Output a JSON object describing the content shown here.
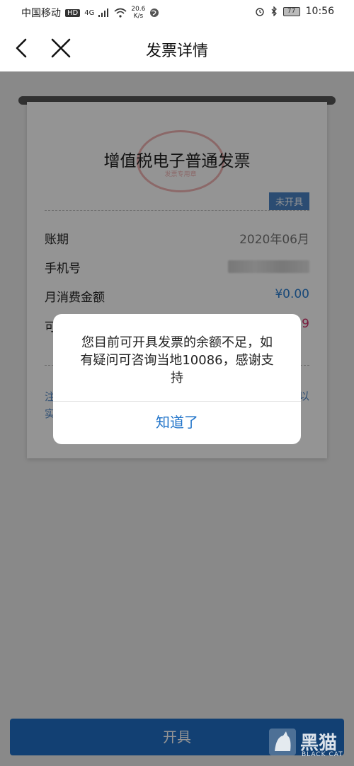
{
  "status_bar": {
    "carrier": "中国移动",
    "hd": "HD",
    "network": "4G",
    "speed_value": "20.6",
    "speed_unit": "K/s",
    "battery": "77",
    "time": "10:56"
  },
  "nav": {
    "title": "发票详情"
  },
  "invoice": {
    "title": "增值税电子普通发票",
    "stamp_text": "发票专用章",
    "status_badge": "未开具",
    "rows": [
      {
        "label": "账期",
        "value": "2020年06月"
      },
      {
        "label": "手机号",
        "value": ""
      },
      {
        "label": "月消费金额",
        "value": "¥0.00"
      },
      {
        "label": "可",
        "value": "9"
      }
    ],
    "note_left": "注\n实",
    "note_right": "以"
  },
  "dialog": {
    "message": "您目前可开具发票的余额不足，如有疑问可咨询当地10086，感谢支持",
    "confirm_label": "知道了"
  },
  "bottom_button": {
    "label": "开具"
  },
  "watermark": {
    "brand_cn": "黑猫",
    "brand_en": "BLACK CAT"
  },
  "colors": {
    "accent": "#1f73c9",
    "badge": "#4a84c4",
    "amount_blue": "#2b7fd0",
    "amount_red": "#d0306a"
  }
}
